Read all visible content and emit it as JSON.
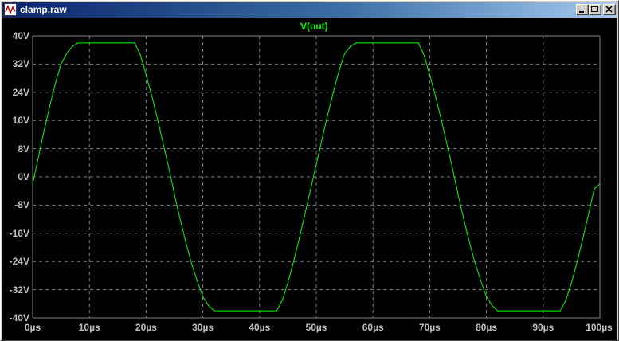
{
  "window": {
    "title": "clamp.raw",
    "icon": "waveform-icon",
    "buttons": {
      "minimize": "minimize-icon",
      "maximize": "maximize-icon",
      "close": "close-icon"
    }
  },
  "colors": {
    "background": "#000000",
    "trace": "#00ff00",
    "grid": "#808080",
    "labels": "#c0c0c0",
    "titlebar_start": "#0a246a",
    "titlebar_end": "#a6caf0"
  },
  "chart_data": {
    "type": "line",
    "title": "V(out)",
    "xlabel": "",
    "ylabel": "",
    "xlim": [
      0,
      100
    ],
    "ylim": [
      -40,
      40
    ],
    "x_unit": "µs",
    "y_unit": "V",
    "grid": true,
    "x_ticks": [
      "0µs",
      "10µs",
      "20µs",
      "30µs",
      "40µs",
      "50µs",
      "60µs",
      "70µs",
      "80µs",
      "90µs",
      "100µs"
    ],
    "y_ticks": [
      "40V",
      "32V",
      "24V",
      "16V",
      "8V",
      "0V",
      "-8V",
      "-16V",
      "-24V",
      "-32V",
      "-40V"
    ],
    "series": [
      {
        "name": "V(out)",
        "x": [
          0,
          1,
          2,
          3,
          4,
          5,
          6,
          7,
          8,
          13,
          18,
          19,
          20,
          21,
          22,
          23,
          24,
          25,
          26,
          27,
          28,
          29,
          30,
          31,
          32,
          33,
          38,
          43,
          44,
          45,
          46,
          47,
          48,
          49,
          50,
          51,
          52,
          53,
          54,
          55,
          56,
          57,
          58,
          63,
          68,
          69,
          70,
          71,
          72,
          73,
          74,
          75,
          76,
          77,
          78,
          79,
          80,
          81,
          82,
          83,
          88,
          93,
          94,
          95,
          96,
          97,
          98,
          99,
          100
        ],
        "y": [
          -2,
          5.5,
          13,
          20,
          26.5,
          32,
          35,
          37,
          38,
          38,
          38,
          34.5,
          29,
          23,
          16.5,
          9.5,
          2.5,
          -5,
          -12,
          -18.5,
          -24.5,
          -29.5,
          -34,
          -36.5,
          -38,
          -38,
          -38,
          -38,
          -35,
          -30,
          -24,
          -17.5,
          -10.5,
          -3.5,
          3.5,
          10.5,
          17.5,
          24,
          30,
          35,
          37,
          38,
          38,
          38,
          38,
          34.5,
          29,
          23,
          16.5,
          9.5,
          2.5,
          -5,
          -12,
          -18.5,
          -24.5,
          -29.5,
          -34,
          -36.5,
          -38,
          -38,
          -38,
          -38,
          -35,
          -30,
          -24,
          -17.5,
          -10.5,
          -3.5,
          -2
        ]
      }
    ]
  }
}
